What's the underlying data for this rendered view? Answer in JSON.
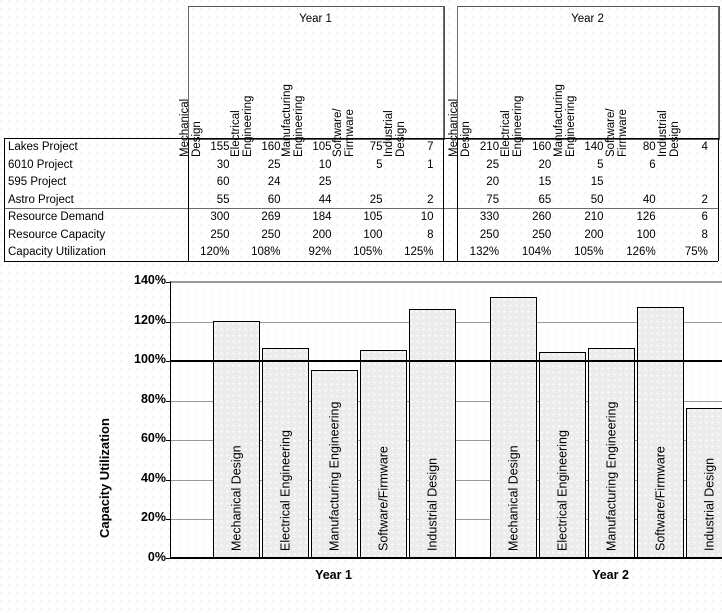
{
  "table": {
    "groups": [
      {
        "title": "Year 1"
      },
      {
        "title": "Year 2"
      }
    ],
    "columns": [
      {
        "line1": "Mechanical",
        "line2": "Design"
      },
      {
        "line1": "Electrical",
        "line2": "Engineering"
      },
      {
        "line1": "Manufacturing",
        "line2": "Engineering"
      },
      {
        "line1": "Software/",
        "line2": "Firmware"
      },
      {
        "line1": "Industrial",
        "line2": "Design"
      }
    ],
    "project_rows": [
      {
        "label": "Lakes Project",
        "y1": [
          "155",
          "160",
          "105",
          "75",
          "7"
        ],
        "y2": [
          "210",
          "160",
          "140",
          "80",
          "4"
        ]
      },
      {
        "label": "6010 Project",
        "y1": [
          "30",
          "25",
          "10",
          "5",
          "1"
        ],
        "y2": [
          "25",
          "20",
          "5",
          "6",
          ""
        ]
      },
      {
        "label": "595 Project",
        "y1": [
          "60",
          "24",
          "25",
          "",
          ""
        ],
        "y2": [
          "20",
          "15",
          "15",
          "",
          ""
        ]
      },
      {
        "label": "Astro Project",
        "y1": [
          "55",
          "60",
          "44",
          "25",
          "2"
        ],
        "y2": [
          "75",
          "65",
          "50",
          "40",
          "2"
        ]
      }
    ],
    "summary_rows": [
      {
        "label": "Resource Demand",
        "y1": [
          "300",
          "269",
          "184",
          "105",
          "10"
        ],
        "y2": [
          "330",
          "260",
          "210",
          "126",
          "6"
        ]
      },
      {
        "label": "Resource Capacity",
        "y1": [
          "250",
          "250",
          "200",
          "100",
          "8"
        ],
        "y2": [
          "250",
          "250",
          "200",
          "100",
          "8"
        ]
      },
      {
        "label": "Capacity Utilization",
        "y1": [
          "120%",
          "108%",
          "92%",
          "105%",
          "125%"
        ],
        "y2": [
          "132%",
          "104%",
          "105%",
          "126%",
          "75%"
        ]
      }
    ]
  },
  "chart_data": {
    "type": "bar",
    "title": "",
    "xlabel": "",
    "ylabel": "Capacity Utilization",
    "ylim": [
      0,
      140
    ],
    "yticks": [
      "0%",
      "20%",
      "40%",
      "60%",
      "80%",
      "100%",
      "120%",
      "140%"
    ],
    "ytick_values": [
      0,
      20,
      40,
      60,
      80,
      100,
      120,
      140
    ],
    "grid": true,
    "legend": "none",
    "reference_line": 100,
    "groups": [
      "Year 1",
      "Year 2"
    ],
    "categories": [
      "Mechanical Design",
      "Electrical Engineering",
      "Manufacturing Engineering",
      "Software/Firmware",
      "Industrial Design",
      "Mechanical Design",
      "Electrical Engineering",
      "Manufacturing Engineering",
      "Software/Firmware",
      "Industrial Design"
    ],
    "values": [
      120,
      106,
      95,
      105,
      126,
      132,
      104,
      106,
      127,
      76
    ],
    "series": [
      {
        "name": "Year 1",
        "categories": [
          "Mechanical Design",
          "Electrical Engineering",
          "Manufacturing Engineering",
          "Software/Firmware",
          "Industrial Design"
        ],
        "values": [
          120,
          106,
          95,
          105,
          126
        ]
      },
      {
        "name": "Year 2",
        "categories": [
          "Mechanical Design",
          "Electrical Engineering",
          "Manufacturing Engineering",
          "Software/Firmware",
          "Industrial Design"
        ],
        "values": [
          132,
          104,
          106,
          127,
          76
        ]
      }
    ]
  }
}
